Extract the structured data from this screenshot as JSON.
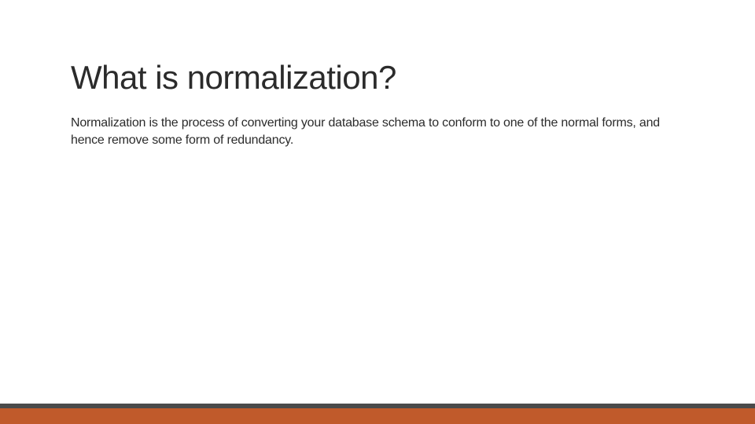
{
  "slide": {
    "title": "What is normalization?",
    "body": "Normalization is the process of converting your database schema to conform to one of the normal forms, and hence remove some form of redundancy."
  },
  "theme": {
    "accent_bar_top": "#4a4a4a",
    "accent_bar_bottom": "#c05a2b"
  }
}
